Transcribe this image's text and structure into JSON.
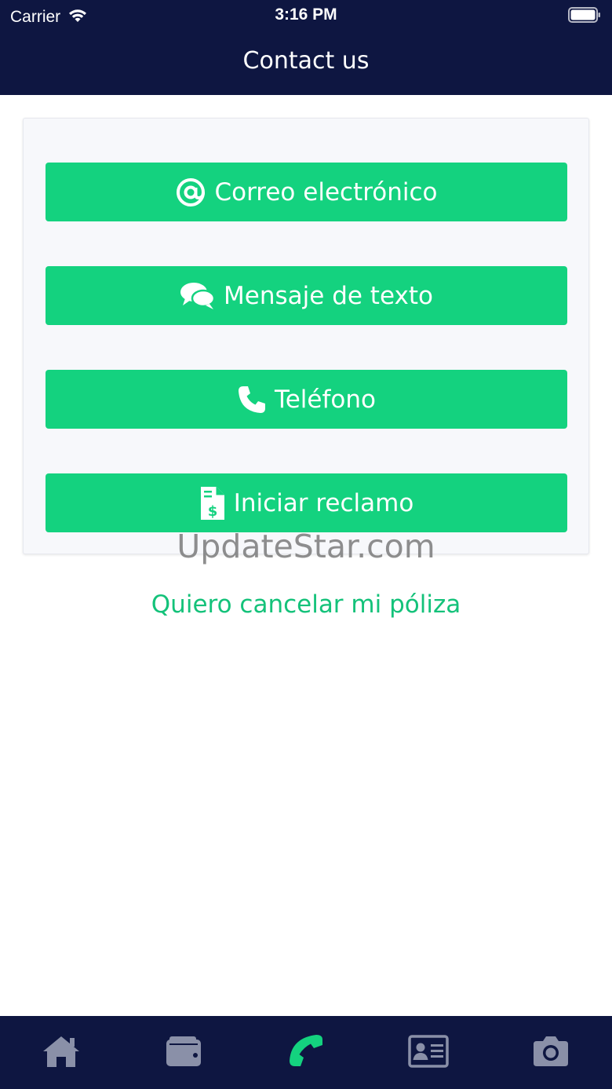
{
  "status_bar": {
    "carrier": "Carrier",
    "time": "3:16 PM"
  },
  "header": {
    "title": "Contact us"
  },
  "contact_options": [
    {
      "label": "Correo electrónico",
      "icon": "at-icon"
    },
    {
      "label": "Mensaje de texto",
      "icon": "chat-bubbles-icon"
    },
    {
      "label": "Teléfono",
      "icon": "phone-icon"
    },
    {
      "label": "Iniciar reclamo",
      "icon": "invoice-dollar-icon"
    }
  ],
  "watermark": "UpdateStar.com",
  "cancel_link": "Quiero cancelar mi póliza",
  "tabbar": {
    "items": [
      {
        "icon": "home-icon",
        "active": false
      },
      {
        "icon": "wallet-icon",
        "active": false
      },
      {
        "icon": "phone-icon",
        "active": true
      },
      {
        "icon": "id-card-icon",
        "active": false
      },
      {
        "icon": "camera-icon",
        "active": false
      }
    ]
  },
  "colors": {
    "header_bg": "#0e1641",
    "accent_green": "#14d27f",
    "link_green": "#14c27a",
    "tab_inactive": "#8a90a8",
    "tab_active": "#14d27f"
  }
}
